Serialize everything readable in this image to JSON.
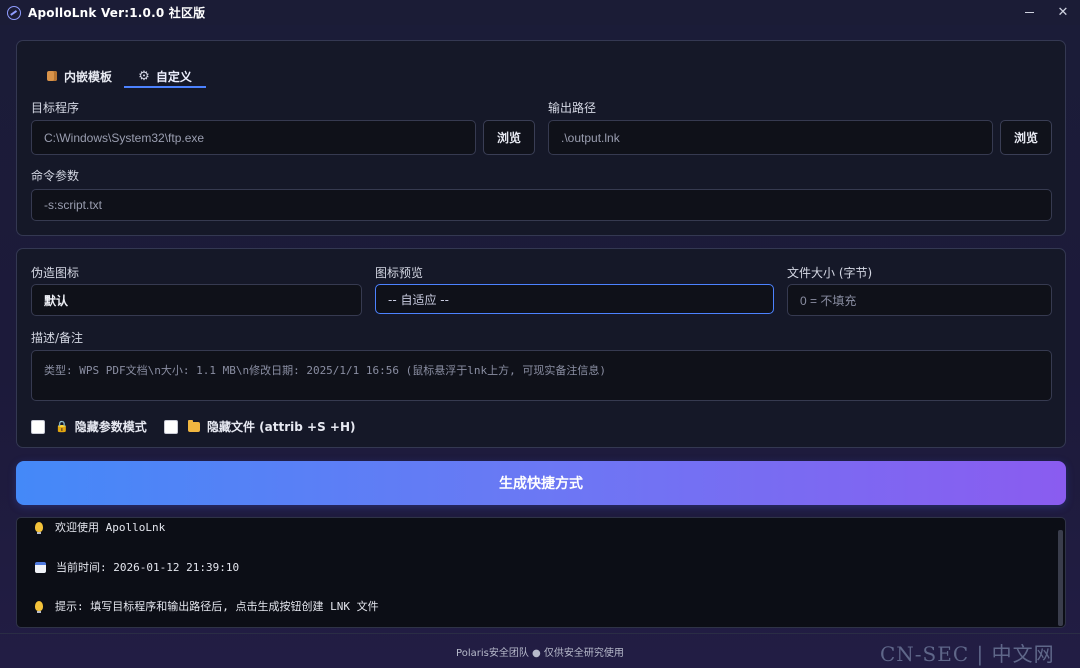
{
  "window": {
    "title": "ApolloLnk Ver:1.0.0 社区版"
  },
  "tabs": [
    {
      "label": "内嵌模板",
      "icon": "package-icon"
    },
    {
      "label": "自定义",
      "icon": "gear-icon",
      "active": true
    }
  ],
  "target": {
    "label": "目标程序",
    "value": "C:\\Windows\\System32\\ftp.exe",
    "browse": "浏览"
  },
  "output": {
    "label": "输出路径",
    "value": ".\\output.lnk",
    "browse": "浏览"
  },
  "args": {
    "label": "命令参数",
    "value": "-s:script.txt"
  },
  "icon_fake": {
    "label": "伪造图标",
    "value": "默认"
  },
  "icon_preview": {
    "label": "图标预览",
    "value": "-- 自适应 --"
  },
  "file_size": {
    "label": "文件大小 (字节)",
    "placeholder": "0 = 不填充"
  },
  "description": {
    "label": "描述/备注",
    "placeholder": "类型: WPS PDF文档\\n大小: 1.1 MB\\n修改日期: 2025/1/1 16:56 (鼠标悬浮于lnk上方, 可现实备注信息)"
  },
  "options": {
    "hide_args": "隐藏参数模式",
    "hide_file": "隐藏文件 (attrib +S +H)"
  },
  "generate_label": "生成快捷方式",
  "log": [
    {
      "icon": "bulb-icon",
      "text": "欢迎使用 ApolloLnk"
    },
    {
      "icon": "calendar-icon",
      "text": "当前时间: 2026-01-12 21:39:10"
    },
    {
      "icon": "bulb-icon",
      "text": "提示: 填写目标程序和输出路径后, 点击生成按钮创建 LNK 文件"
    }
  ],
  "footer": "Polaris安全团队 ● 仅供安全研究使用",
  "watermark": "CN-SEC | 中文网",
  "colors": {
    "accent": "#4c82ff",
    "gradient_start": "#4489f8",
    "gradient_end": "#8a5cf0"
  }
}
